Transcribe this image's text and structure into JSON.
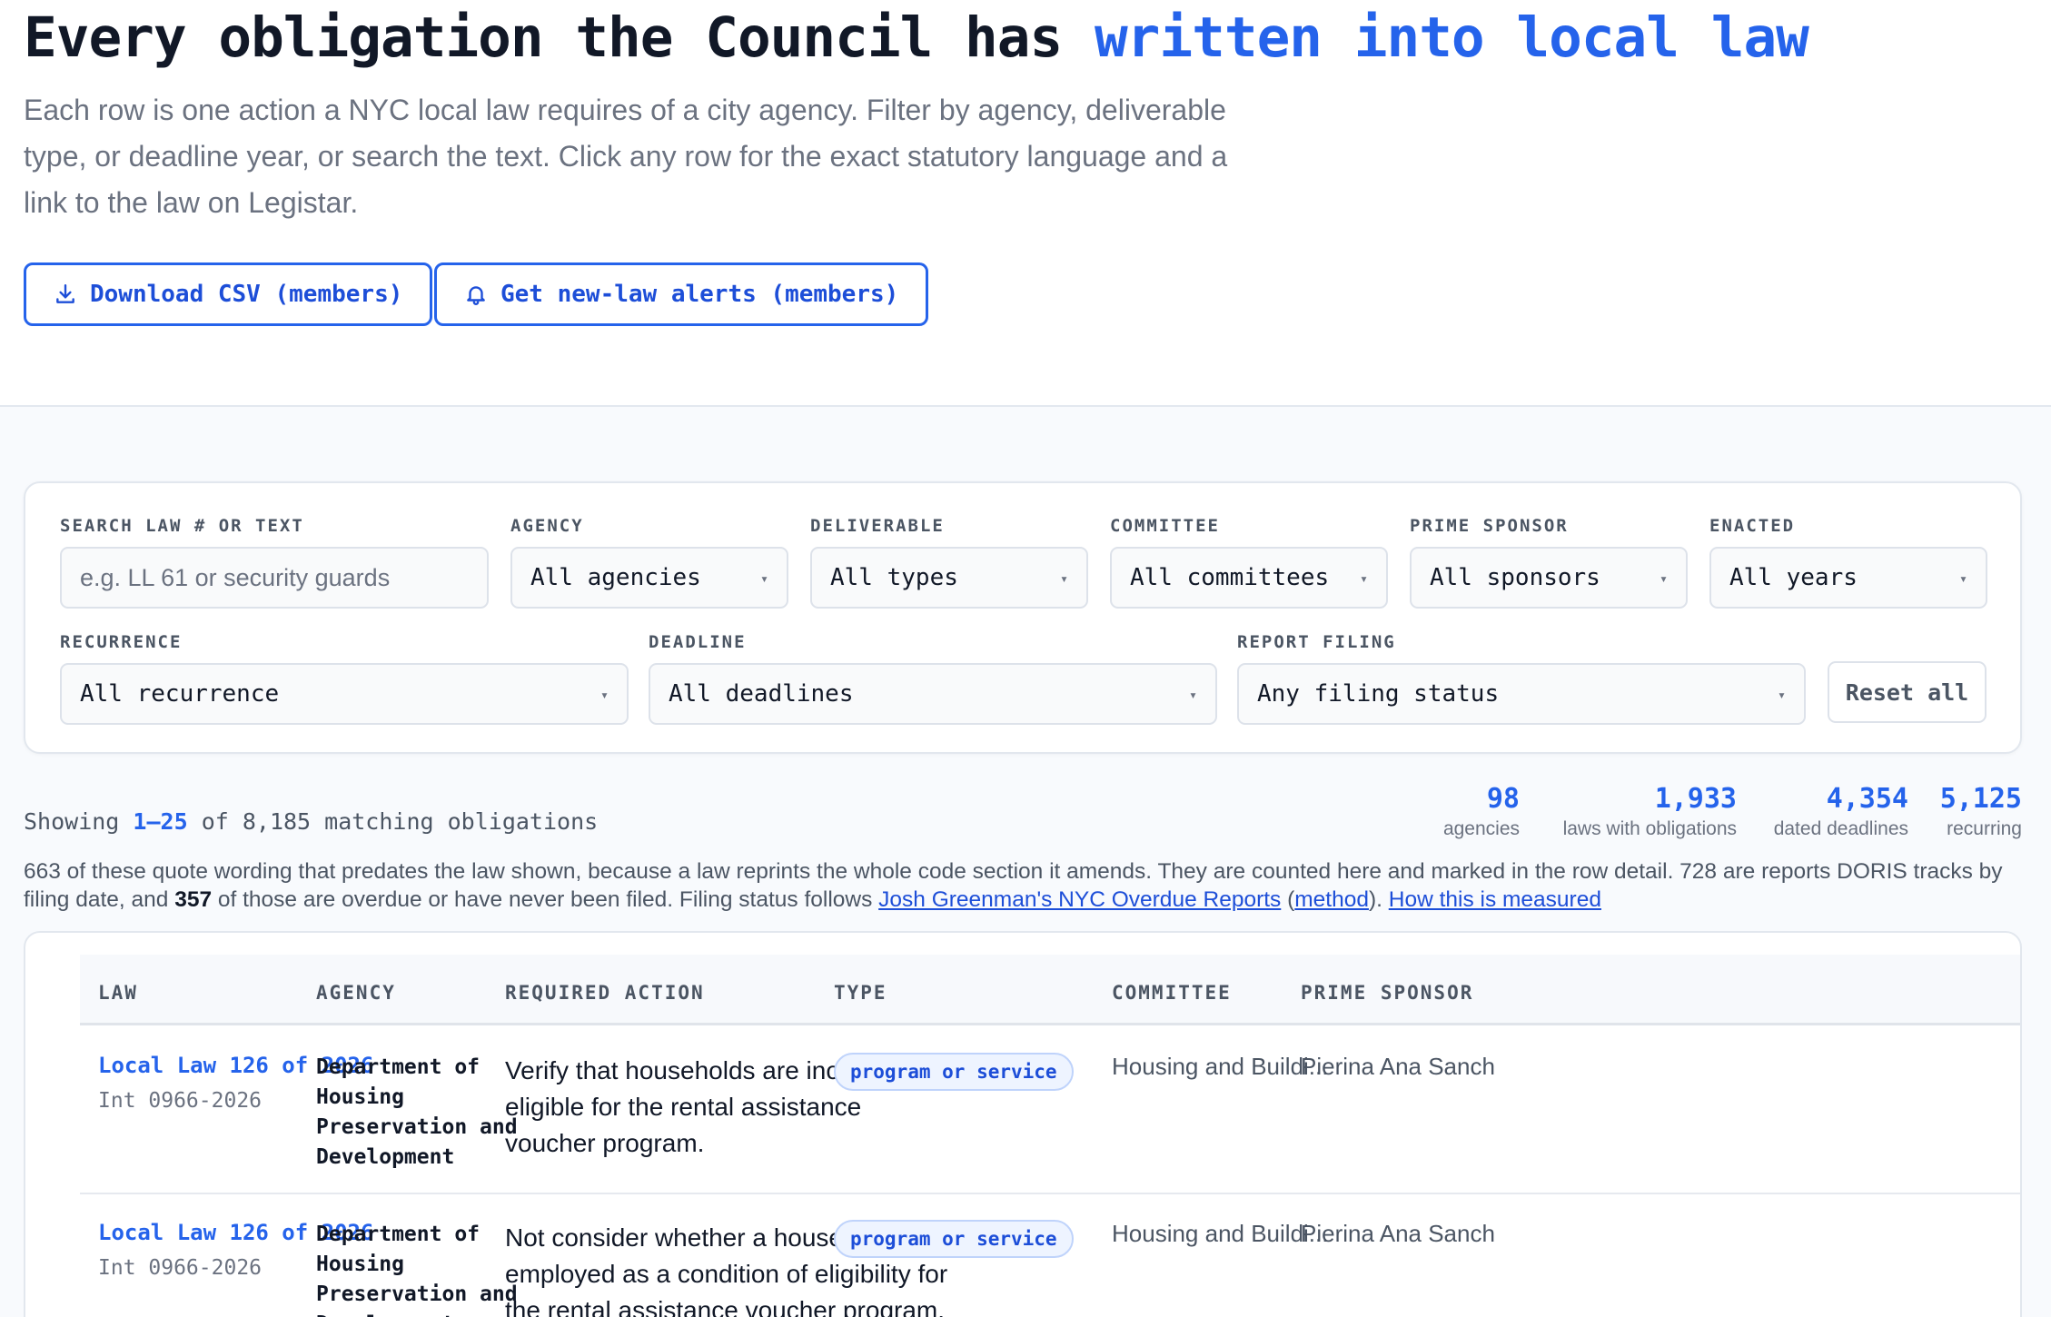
{
  "hero": {
    "title_main": "Every obligation the Council has ",
    "title_highlight": "written into local law",
    "intro": "Each row is one action a NYC local law requires of a city agency. Filter by agency, deliverable type, or deadline year, or search the text. Click any row for the exact statutory language and a link to the law on Legistar.",
    "download_label": "Download CSV (members)",
    "alerts_label": "Get new-law alerts (members)"
  },
  "filters": {
    "search": {
      "label": "SEARCH LAW # OR TEXT",
      "placeholder": "e.g. LL 61 or security guards",
      "value": ""
    },
    "agency": {
      "label": "AGENCY",
      "value": "All agencies"
    },
    "deliverable": {
      "label": "DELIVERABLE",
      "value": "All types"
    },
    "committee": {
      "label": "COMMITTEE",
      "value": "All committees"
    },
    "sponsor": {
      "label": "PRIME SPONSOR",
      "value": "All sponsors"
    },
    "enacted": {
      "label": "ENACTED",
      "value": "All years"
    },
    "recurrence": {
      "label": "RECURRENCE",
      "value": "All recurrence"
    },
    "deadline": {
      "label": "DEADLINE",
      "value": "All deadlines"
    },
    "filing": {
      "label": "REPORT FILING",
      "value": "Any filing status"
    },
    "reset_label": "Reset all",
    "caret": "▾"
  },
  "summary": {
    "showing_prefix": "Showing ",
    "range": "1–25",
    "showing_suffix": " of 8,185 matching obligations",
    "stats": [
      {
        "num": "98",
        "label": "agencies"
      },
      {
        "num": "1,933",
        "label": "laws with obligations"
      },
      {
        "num": "4,354",
        "label": "dated deadlines"
      },
      {
        "num": "5,125",
        "label": "recurring"
      }
    ]
  },
  "note": {
    "part1": "663 of these quote wording that predates the law shown, because a law reprints the whole code section it amends. They are counted here and marked in the row detail. 728 are reports DORIS tracks by filing date, and ",
    "overdue": "357",
    "part2": " of those are overdue or have never been filed. Filing status follows ",
    "link1": "Josh Greenman's NYC Overdue Reports",
    "part3": " (",
    "link2": "method",
    "part4": "). ",
    "link3": "How this is measured"
  },
  "table": {
    "headers": {
      "law": "LAW",
      "agency": "AGENCY",
      "action": "REQUIRED ACTION",
      "type": "TYPE",
      "committee": "COMMITTEE",
      "sponsor": "PRIME SPONSOR"
    },
    "rows": [
      {
        "law": "Local Law 126 of 2026",
        "intro_no": "Int 0966-2026",
        "agency": "Department of Housing Preservation and Development",
        "action": "Verify that households are income-eligible for the rental assistance voucher program.",
        "type": "program or service",
        "committee": "Housing and Buildi...",
        "sponsor": "Pierina Ana Sanch"
      },
      {
        "law": "Local Law 126 of 2026",
        "intro_no": "Int 0966-2026",
        "agency": "Department of Housing Preservation and Development",
        "action": "Not consider whether a household is employed as a condition of eligibility for the rental assistance voucher program.",
        "type": "program or service",
        "committee": "Housing and Buildi...",
        "sponsor": "Pierina Ana Sanch"
      }
    ]
  }
}
